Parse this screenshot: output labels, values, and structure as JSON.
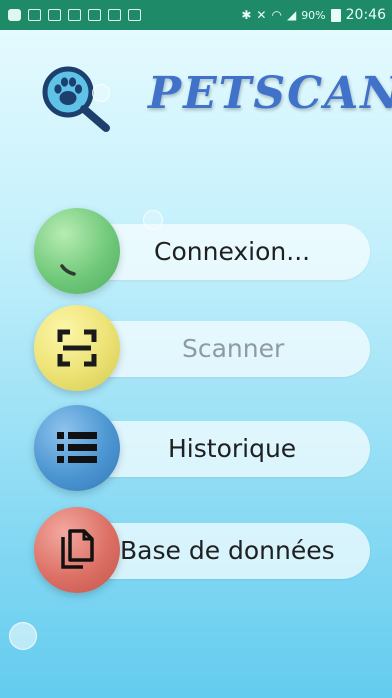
{
  "status_bar": {
    "battery": "90%",
    "time": "20:46"
  },
  "header": {
    "title": "PETSCAN",
    "logo_icon": "paw-magnifier-icon"
  },
  "menu": {
    "items": [
      {
        "label": "Connexion...",
        "icon": "loading-spinner-icon",
        "color": "#71c97a",
        "enabled": true
      },
      {
        "label": "Scanner",
        "icon": "scan-frame-icon",
        "color": "#ece274",
        "enabled": false
      },
      {
        "label": "Historique",
        "icon": "list-icon",
        "color": "#4c96d2",
        "enabled": true
      },
      {
        "label": "Base de données",
        "icon": "copy-documents-icon",
        "color": "#dc7065",
        "enabled": true
      }
    ]
  },
  "colors": {
    "title": "#3f72c8",
    "status_bar": "#1f8a68"
  }
}
